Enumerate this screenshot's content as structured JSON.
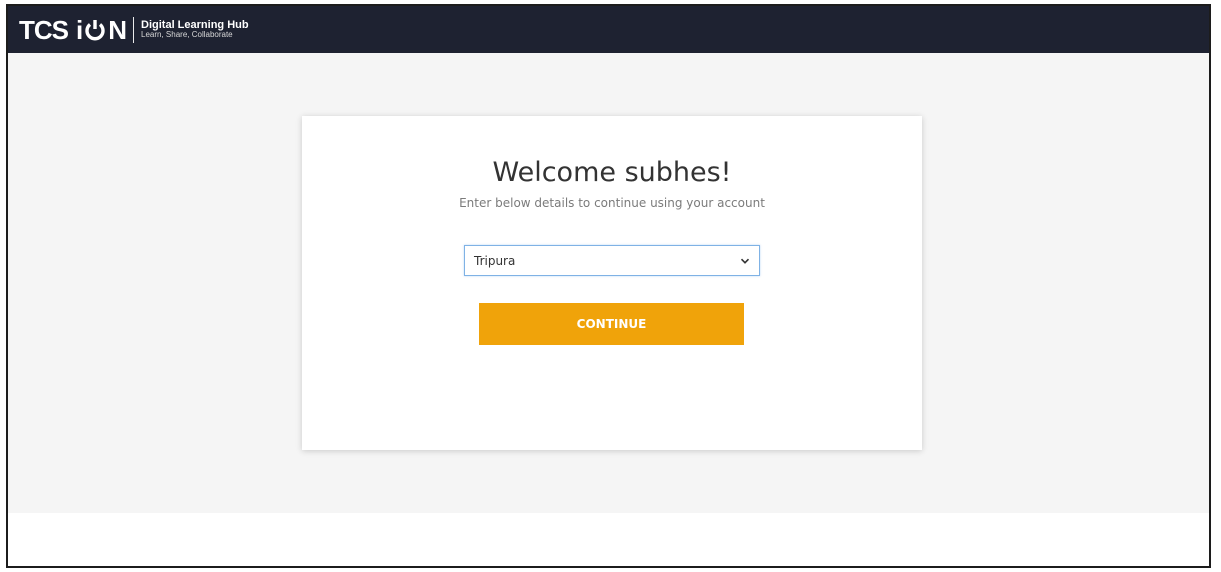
{
  "brand": {
    "logo_prefix": "TCS",
    "logo_i": "i",
    "logo_n": "N",
    "title": "Digital Learning Hub",
    "tagline": "Learn, Share, Collaborate"
  },
  "welcome": {
    "heading": "Welcome subhes!",
    "subtitle": "Enter below details to continue using your account"
  },
  "form": {
    "state_selected": "Tripura",
    "continue_label": "CONTINUE"
  },
  "colors": {
    "topbar": "#1e2231",
    "accent": "#f0a30a",
    "background": "#f5f5f5"
  },
  "icons": {
    "logo_o": "power-icon",
    "dropdown": "chevron-down-icon"
  }
}
